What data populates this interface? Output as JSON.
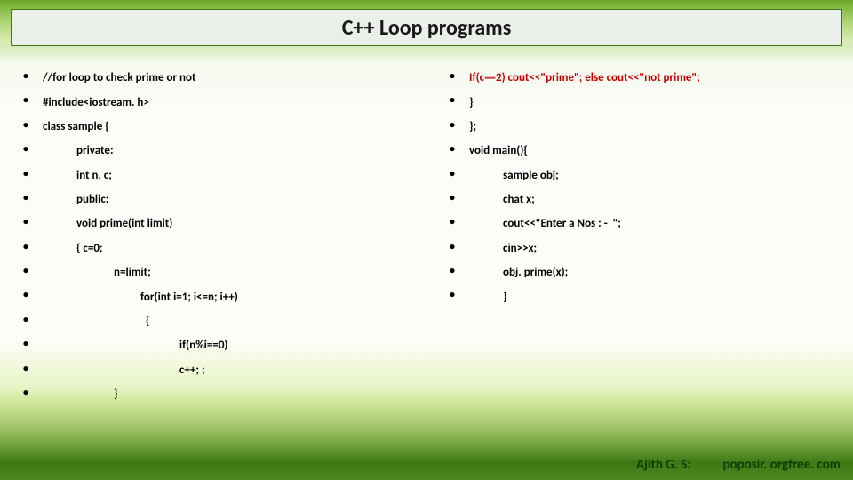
{
  "title": "C++ Loop programs",
  "left": [
    {
      "indent": 0,
      "text": "//for loop to check prime or not",
      "red": false
    },
    {
      "indent": 0,
      "text": "#include<iostream. h>",
      "red": false
    },
    {
      "indent": 0,
      "text": "class sample {",
      "red": false
    },
    {
      "indent": 1,
      "text": "private:",
      "red": false
    },
    {
      "indent": 1,
      "text": "int n, c;",
      "red": false
    },
    {
      "indent": 1,
      "text": "public:",
      "red": false
    },
    {
      "indent": 1,
      "text": "void prime(int limit)",
      "red": false
    },
    {
      "indent": 1,
      "text": "{ c=0;",
      "red": false
    },
    {
      "indent": 2,
      "text": "n=limit;",
      "red": false
    },
    {
      "indent": 3,
      "text": "for(int i=1; i<=n; i++)",
      "red": false
    },
    {
      "indent": 3,
      "text": "  {",
      "red": false
    },
    {
      "indent": 4,
      "text": "  if(n%i==0)",
      "red": false
    },
    {
      "indent": 4,
      "text": "  c++; ;",
      "red": false
    },
    {
      "indent": 2,
      "text": "}",
      "red": false
    }
  ],
  "right": [
    {
      "indent": 0,
      "text": "If(c==2) cout<<\"prime\"; else cout<<\"not prime\";",
      "red": true
    },
    {
      "indent": 0,
      "text": "}",
      "red": false
    },
    {
      "indent": 0,
      "text": "};",
      "red": false
    },
    {
      "indent": 0,
      "text": "void main(){",
      "red": false
    },
    {
      "indent": 1,
      "text": "sample obj;",
      "red": false
    },
    {
      "indent": 1,
      "text": "chat x;",
      "red": false
    },
    {
      "indent": 1,
      "text": "cout<<\"Enter a Nos : -  \";",
      "red": false
    },
    {
      "indent": 1,
      "text": "cin>>x;",
      "red": false
    },
    {
      "indent": 1,
      "text": "obj. prime(x);",
      "red": false
    },
    {
      "indent": 1,
      "text": "}",
      "red": false
    }
  ],
  "footer_author": "Ajith G. S:",
  "footer_site": "poposir. orgfree. com"
}
